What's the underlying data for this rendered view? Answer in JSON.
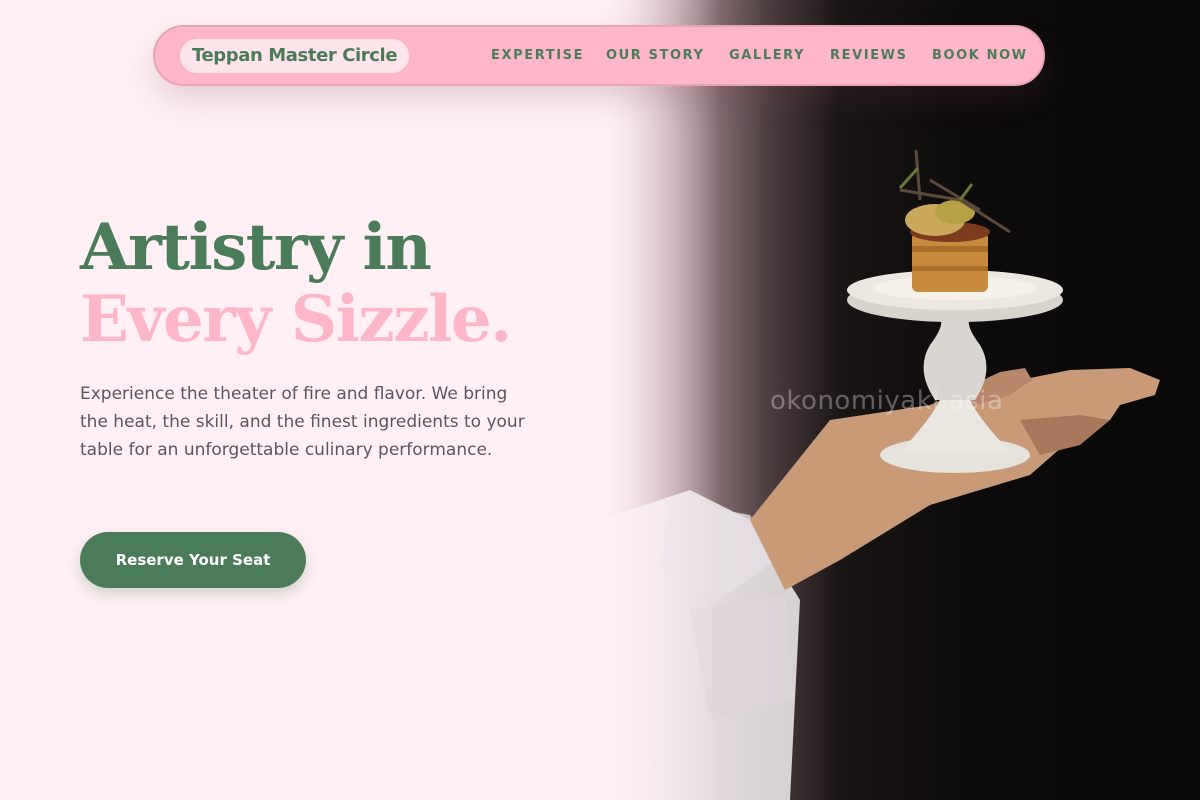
{
  "colors": {
    "primary_green": "#4a7c59",
    "accent_pink": "#ffb6c8",
    "page_background": "#fff0f5",
    "body_text": "#5a5560"
  },
  "header": {
    "brand": "Teppan Master Circle",
    "nav": [
      {
        "label": "EXPERTISE"
      },
      {
        "label": "OUR STORY"
      },
      {
        "label": "GALLERY"
      },
      {
        "label": "REVIEWS"
      },
      {
        "label": "BOOK NOW"
      }
    ]
  },
  "hero": {
    "headline_line1": "Artistry in",
    "headline_line2": "Every Sizzle.",
    "description": "Experience the theater of fire and flavor. We bring the heat, the skill, and the finest ingredients to your table for an unforgettable culinary performance.",
    "cta_label": "Reserve Your Seat",
    "image_watermark": "okonomiyaki.asia"
  }
}
